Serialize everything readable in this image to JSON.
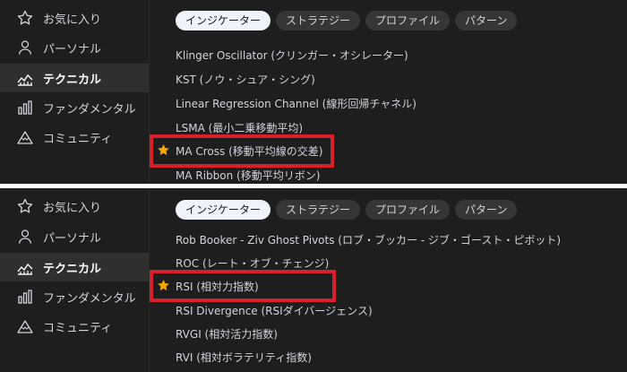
{
  "colors": {
    "background": "#1e1e1e",
    "active_item": "#2f2f2f",
    "text": "#d1d4dc",
    "star": "#f7a600",
    "highlight": "#d8202a"
  },
  "panels": [
    {
      "sidebar": {
        "items": [
          {
            "label": "お気に入り",
            "icon": "star-outline-icon"
          },
          {
            "label": "パーソナル",
            "icon": "user-icon"
          },
          {
            "label": "テクニカル",
            "icon": "chart-line-icon",
            "active": true
          },
          {
            "label": "ファンダメンタル",
            "icon": "bar-chart-icon"
          },
          {
            "label": "コミュニティ",
            "icon": "mountain-icon"
          }
        ]
      },
      "tabs": [
        {
          "label": "インジケーター",
          "active": true
        },
        {
          "label": "ストラテジー"
        },
        {
          "label": "プロファイル"
        },
        {
          "label": "パターン"
        }
      ],
      "rows": [
        {
          "label": "Klinger Oscillator (クリンガー・オシレーター)"
        },
        {
          "label": "KST (ノウ・シュア・シング)"
        },
        {
          "label": "Linear Regression Channel (線形回帰チャネル)"
        },
        {
          "label": "LSMA (最小二乗移動平均)"
        },
        {
          "label": "MA Cross (移動平均線の交差)",
          "favorite": true,
          "highlighted": true
        },
        {
          "label": "MA Ribbon (移動平均リボン)"
        }
      ]
    },
    {
      "sidebar": {
        "items": [
          {
            "label": "お気に入り",
            "icon": "star-outline-icon"
          },
          {
            "label": "パーソナル",
            "icon": "user-icon"
          },
          {
            "label": "テクニカル",
            "icon": "chart-line-icon",
            "active": true
          },
          {
            "label": "ファンダメンタル",
            "icon": "bar-chart-icon"
          },
          {
            "label": "コミュニティ",
            "icon": "mountain-icon"
          }
        ]
      },
      "tabs": [
        {
          "label": "インジケーター",
          "active": true
        },
        {
          "label": "ストラテジー"
        },
        {
          "label": "プロファイル"
        },
        {
          "label": "パターン"
        }
      ],
      "rows": [
        {
          "label": "Rob Booker - Ziv Ghost Pivots (ロブ・ブッカー - ジブ・ゴースト・ピボット)"
        },
        {
          "label": "ROC (レート・オブ・チェンジ)"
        },
        {
          "label": "RSI (相対力指数)",
          "favorite": true,
          "highlighted": true
        },
        {
          "label": "RSI Divergence (RSIダイバージェンス)"
        },
        {
          "label": "RVGI (相対活力指数)"
        },
        {
          "label": "RVI (相対ボラテリティ指数)"
        }
      ]
    }
  ]
}
